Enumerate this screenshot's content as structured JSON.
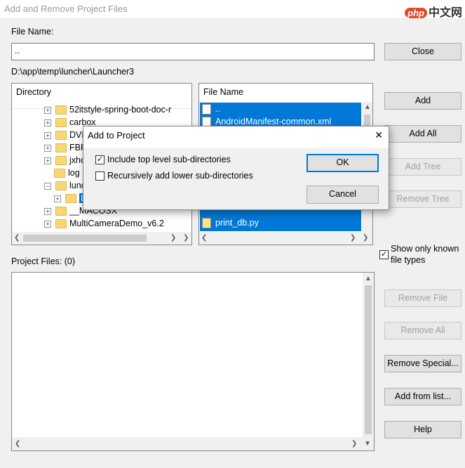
{
  "window": {
    "title": "Add and Remove Project Files",
    "watermark": {
      "badge": "php",
      "text": "中文网"
    }
  },
  "file_name": {
    "label": "File Name:",
    "value": ".."
  },
  "current_path": "D:\\app\\temp\\luncher\\Launcher3",
  "directory": {
    "header": "Directory",
    "items": [
      "52itstyle-spring-boot-doc-r",
      "carbox",
      "DVR",
      "FBR",
      "jxho",
      "log",
      "lunc",
      "L",
      "__MACOSX",
      "MultiCameraDemo_v6.2"
    ]
  },
  "files": {
    "header": "File Name",
    "items": [
      "..",
      "AndroidManifest-common.xml",
      "print_db.py"
    ]
  },
  "buttons": {
    "close": "Close",
    "add": "Add",
    "add_all": "Add All",
    "add_tree": "Add Tree",
    "remove_tree": "Remove Tree",
    "remove_file": "Remove File",
    "remove_all": "Remove All",
    "remove_special": "Remove Special...",
    "add_from_list": "Add from list...",
    "help": "Help"
  },
  "show_known": {
    "label": "Show only known file types",
    "checked": true
  },
  "project_files": {
    "label": "Project Files: (0)"
  },
  "dialog": {
    "title": "Add to Project",
    "include_top": {
      "label": "Include top level sub-directories",
      "checked": true
    },
    "recursive": {
      "label": "Recursively add lower sub-directories",
      "checked": false
    },
    "ok": "OK",
    "cancel": "Cancel"
  }
}
